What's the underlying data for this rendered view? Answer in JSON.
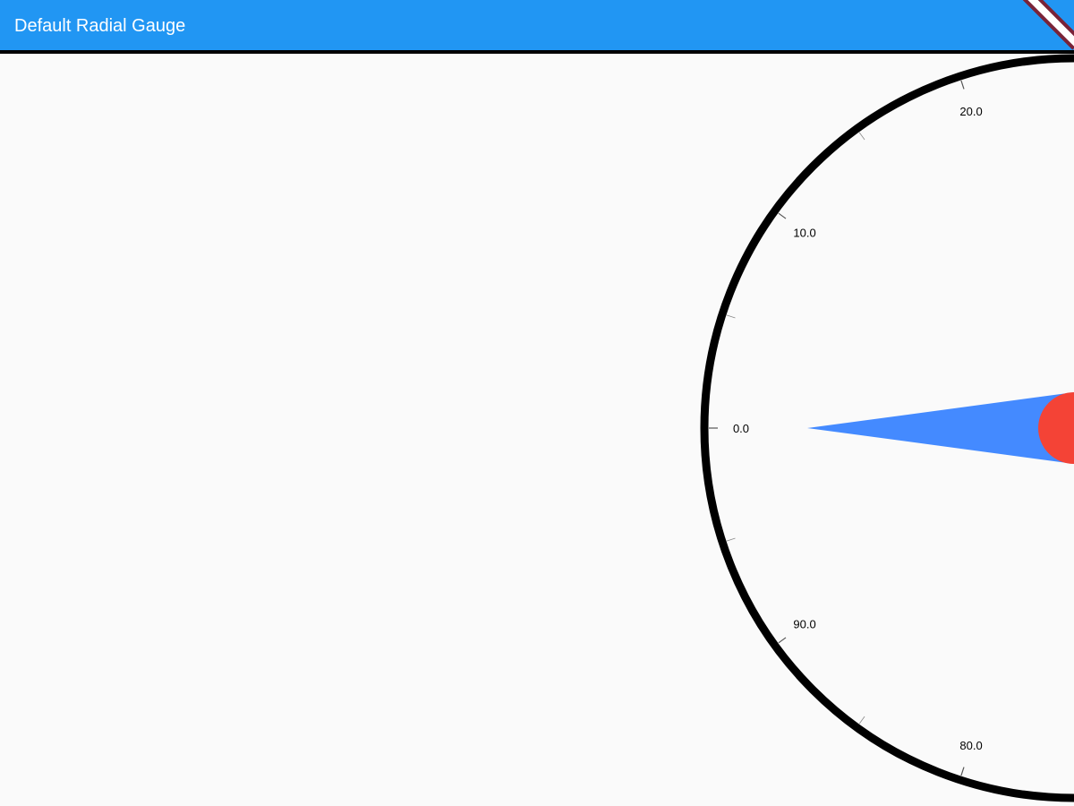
{
  "app_bar": {
    "title": "Default Radial Gauge",
    "color": "#2196f3"
  },
  "gauge": {
    "value": 0.0,
    "min": 0.0,
    "max": 100.0,
    "labels": [
      {
        "text": "0.0",
        "value": 0
      },
      {
        "text": "10.0",
        "value": 10
      },
      {
        "text": "20.0",
        "value": 20
      },
      {
        "text": "80.0",
        "value": 80
      },
      {
        "text": "90.0",
        "value": 90
      }
    ],
    "minor_ticks": [
      5,
      15,
      85,
      95
    ],
    "needle_color": "#448aff",
    "knob_color": "#f44336",
    "rim_color": "#000000"
  }
}
